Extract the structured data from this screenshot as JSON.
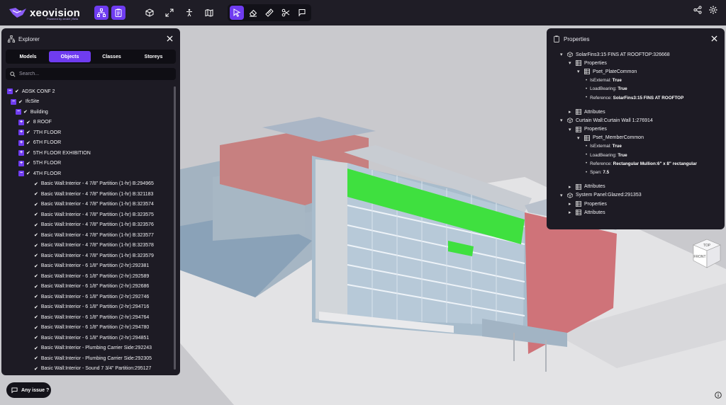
{
  "app": {
    "logo_text": "xeovision",
    "logo_sub": "Powered by xeokit | Beta"
  },
  "toolbar": {
    "left_buttons": [
      {
        "icon": "hierarchy-icon",
        "active": true
      },
      {
        "icon": "clipboard-icon",
        "active": true
      }
    ],
    "view_buttons": [
      "cube-icon",
      "expand-icon",
      "person-icon",
      "map-icon"
    ],
    "tool_buttons": [
      {
        "icon": "cursor-icon",
        "active": true
      },
      {
        "icon": "eraser-icon",
        "active": false
      },
      {
        "icon": "ruler-icon",
        "active": false
      },
      {
        "icon": "scissors-icon",
        "active": false
      },
      {
        "icon": "comment-flag-icon",
        "active": false
      }
    ],
    "right_buttons": [
      "share-icon",
      "settings-icon"
    ]
  },
  "explorer": {
    "title": "Explorer",
    "tabs": [
      {
        "label": "Models",
        "active": false
      },
      {
        "label": "Objects",
        "active": true
      },
      {
        "label": "Classes",
        "active": false
      },
      {
        "label": "Storeys",
        "active": false
      }
    ],
    "search_placeholder": "Search...",
    "tree": [
      {
        "label": "ADSK CONF 2",
        "level": 0,
        "toggle": "−"
      },
      {
        "label": "IfcSite",
        "level": 1,
        "toggle": "−"
      },
      {
        "label": "Building",
        "level": 2,
        "toggle": "−"
      },
      {
        "label": "8 ROOF",
        "level": 3,
        "toggle": "+"
      },
      {
        "label": "7TH FLOOR",
        "level": 3,
        "toggle": "+"
      },
      {
        "label": "6TH FLOOR",
        "level": 3,
        "toggle": "+"
      },
      {
        "label": "5TH FLOOR EXHIBITION",
        "level": 3,
        "toggle": "+"
      },
      {
        "label": "5TH FLOOR",
        "level": 3,
        "toggle": "+"
      },
      {
        "label": "4TH FLOOR",
        "level": 3,
        "toggle": "−"
      },
      {
        "label": "Basic Wall:Interior - 4 7/8\" Partition (1-hr) B:294965",
        "level": 4,
        "toggle": ""
      },
      {
        "label": "Basic Wall:Interior - 4 7/8\" Partition (1-hr) B:321183",
        "level": 4,
        "toggle": ""
      },
      {
        "label": "Basic Wall:Interior - 4 7/8\" Partition (1-hr) B:323574",
        "level": 4,
        "toggle": ""
      },
      {
        "label": "Basic Wall:Interior - 4 7/8\" Partition (1-hr) B:323575",
        "level": 4,
        "toggle": ""
      },
      {
        "label": "Basic Wall:Interior - 4 7/8\" Partition (1-hr) B:323576",
        "level": 4,
        "toggle": ""
      },
      {
        "label": "Basic Wall:Interior - 4 7/8\" Partition (1-hr) B:323577",
        "level": 4,
        "toggle": ""
      },
      {
        "label": "Basic Wall:Interior - 4 7/8\" Partition (1-hr) B:323578",
        "level": 4,
        "toggle": ""
      },
      {
        "label": "Basic Wall:Interior - 4 7/8\" Partition (1-hr) B:323579",
        "level": 4,
        "toggle": ""
      },
      {
        "label": "Basic Wall:Interior - 6 1/8\" Partition (2-hr):292381",
        "level": 4,
        "toggle": ""
      },
      {
        "label": "Basic Wall:Interior - 6 1/8\" Partition (2-hr):292589",
        "level": 4,
        "toggle": ""
      },
      {
        "label": "Basic Wall:Interior - 6 1/8\" Partition (2-hr):292686",
        "level": 4,
        "toggle": ""
      },
      {
        "label": "Basic Wall:Interior - 6 1/8\" Partition (2-hr):292746",
        "level": 4,
        "toggle": ""
      },
      {
        "label": "Basic Wall:Interior - 6 1/8\" Partition (2-hr):294716",
        "level": 4,
        "toggle": ""
      },
      {
        "label": "Basic Wall:Interior - 6 1/8\" Partition (2-hr):294764",
        "level": 4,
        "toggle": ""
      },
      {
        "label": "Basic Wall:Interior - 6 1/8\" Partition (2-hr):294780",
        "level": 4,
        "toggle": ""
      },
      {
        "label": "Basic Wall:Interior - 6 1/8\" Partition (2-hr):294851",
        "level": 4,
        "toggle": ""
      },
      {
        "label": "Basic Wall:Interior - Plumbing Carrier Side:292243",
        "level": 4,
        "toggle": ""
      },
      {
        "label": "Basic Wall:Interior - Plumbing Carrier Side:292305",
        "level": 4,
        "toggle": ""
      },
      {
        "label": "Basic Wall:Interior - Sound 7 3/4\" Partition:295127",
        "level": 4,
        "toggle": ""
      }
    ]
  },
  "properties": {
    "title": "Properties",
    "rows": [
      {
        "type": "object",
        "level": 0,
        "caret": "▾",
        "label": "SolarFins3:15 FINS AT ROOFTOP:326668"
      },
      {
        "type": "group",
        "level": 1,
        "caret": "▾",
        "label": "Properties"
      },
      {
        "type": "group",
        "level": 2,
        "caret": "▾",
        "label": "Pset_PlateCommon"
      },
      {
        "type": "kv",
        "level": 3,
        "key": "IsExternal:",
        "value": "True"
      },
      {
        "type": "kv",
        "level": 3,
        "key": "LoadBearing:",
        "value": "True"
      },
      {
        "type": "kv",
        "level": 3,
        "key": "Reference:",
        "value": "SolarFins3:15 FINS AT ROOFTOP"
      },
      {
        "type": "spacer"
      },
      {
        "type": "group",
        "level": 1,
        "caret": "▸",
        "label": "Attributes"
      },
      {
        "type": "object",
        "level": 0,
        "caret": "▾",
        "label": "Curtain Wall:Curtain Wall 1:276914"
      },
      {
        "type": "group",
        "level": 1,
        "caret": "▾",
        "label": "Properties"
      },
      {
        "type": "group",
        "level": 2,
        "caret": "▾",
        "label": "Pset_MemberCommon"
      },
      {
        "type": "kv",
        "level": 3,
        "key": "IsExternal:",
        "value": "True"
      },
      {
        "type": "kv",
        "level": 3,
        "key": "LoadBearing:",
        "value": "True"
      },
      {
        "type": "kv",
        "level": 3,
        "key": "Reference:",
        "value": "Rectangular Mullion:6\" x 8\" rectangular"
      },
      {
        "type": "kv",
        "level": 3,
        "key": "Span:",
        "value": "7.5"
      },
      {
        "type": "spacer"
      },
      {
        "type": "group",
        "level": 1,
        "caret": "▸",
        "label": "Attributes"
      },
      {
        "type": "object",
        "level": 0,
        "caret": "▾",
        "label": "System Panel:Glazed:291353"
      },
      {
        "type": "group",
        "level": 1,
        "caret": "▸",
        "label": "Properties"
      },
      {
        "type": "group",
        "level": 1,
        "caret": "▸",
        "label": "Attributes"
      }
    ]
  },
  "viewcube": {
    "top_label": "TOP",
    "front_label": "FRONT"
  },
  "issue_button": {
    "label": "Any issue ?"
  },
  "colors": {
    "accent": "#6f3cf0",
    "panel_bg": "#1d1b24",
    "topbar_bg": "#1f1d26",
    "selection_green": "#3fe03f"
  }
}
